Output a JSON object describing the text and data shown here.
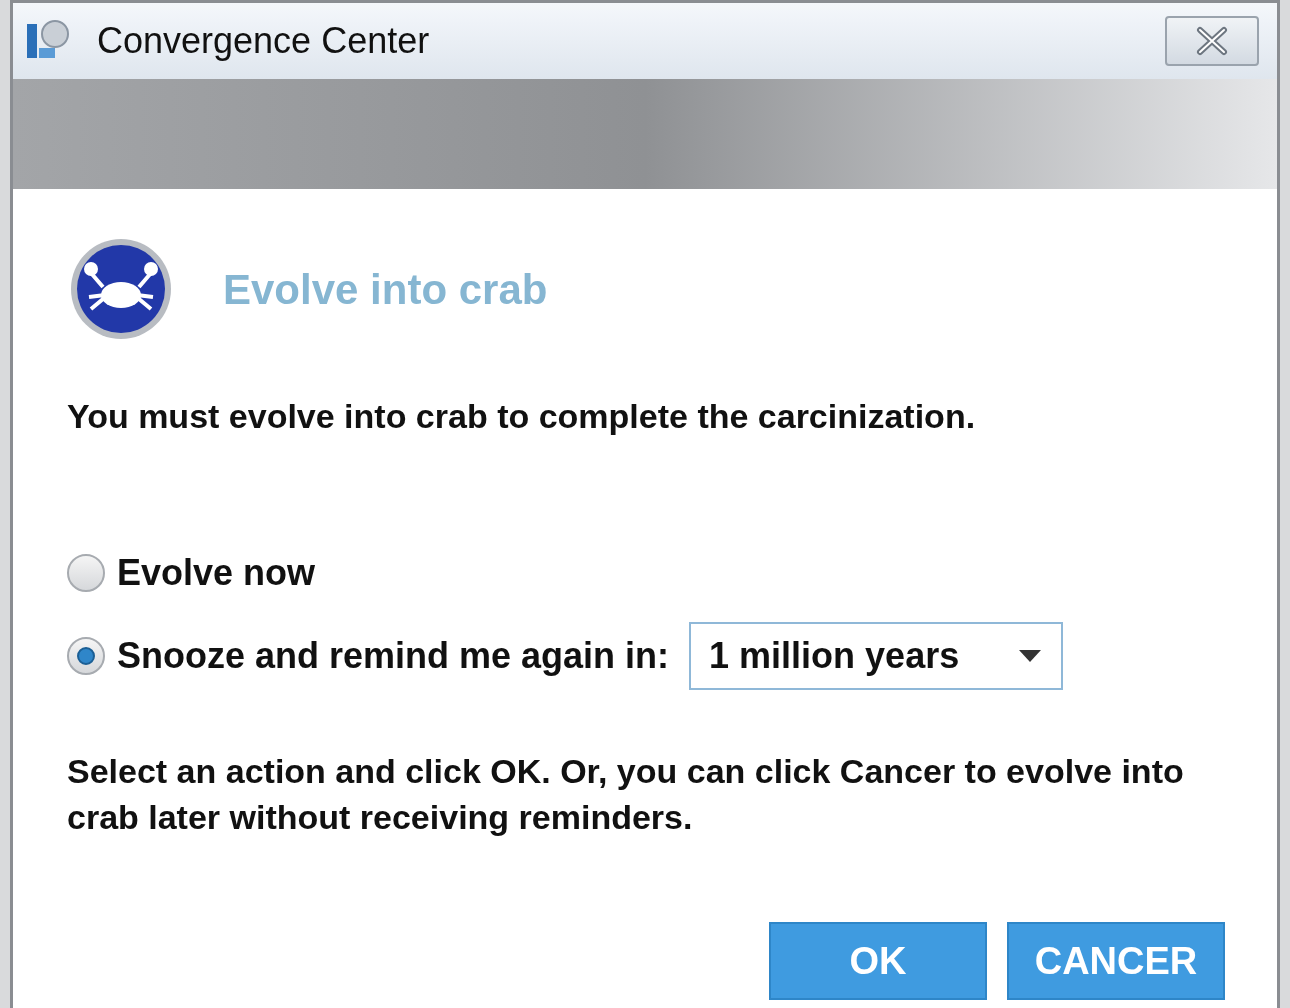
{
  "window": {
    "title": "Convergence Center"
  },
  "heading": "Evolve into crab",
  "message": "You must evolve into crab to complete the carcinization.",
  "options": [
    {
      "label": "Evolve now",
      "selected": false
    },
    {
      "label": "Snooze and remind me again in:",
      "selected": true,
      "dropdown": "1 million years"
    }
  ],
  "instructions": "Select an action and click OK. Or, you can click Cancer to evolve into crab later without receiving reminders.",
  "buttons": [
    "OK",
    "CANCER"
  ]
}
